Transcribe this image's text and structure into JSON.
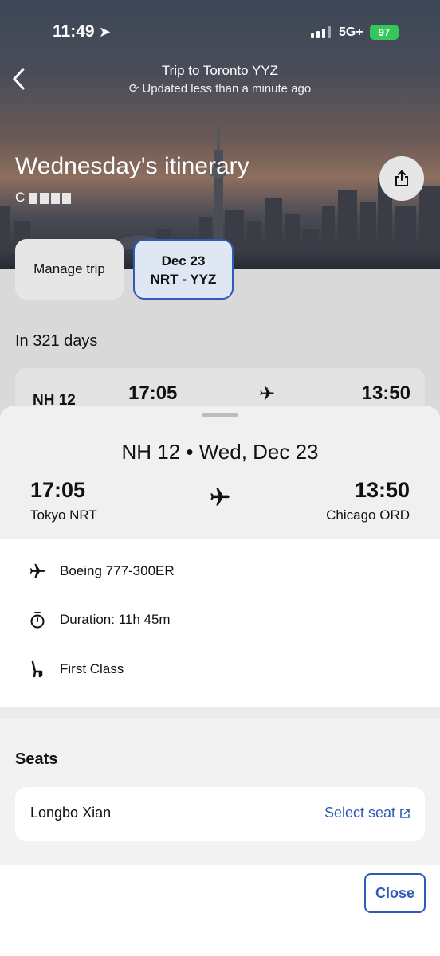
{
  "status_bar": {
    "time": "11:49",
    "network": "5G+",
    "battery": "97"
  },
  "header": {
    "trip_title": "Trip to Toronto YYZ",
    "updated": "Updated less than a minute ago",
    "day_title": "Wednesday's itinerary",
    "confirmation_prefix": "C"
  },
  "chips": {
    "manage": "Manage trip",
    "flight_date": "Dec 23",
    "flight_route": "NRT - YYZ"
  },
  "countdown": "In 321 days",
  "peek_card": {
    "flight": "NH 12",
    "departure_time": "17:05",
    "arrival_time": "13:50"
  },
  "sheet": {
    "title": "NH 12 • Wed, Dec 23",
    "departure_time": "17:05",
    "departure_city": "Tokyo NRT",
    "arrival_time": "13:50",
    "arrival_city": "Chicago ORD",
    "details": {
      "aircraft": "Boeing 777-300ER",
      "duration": "Duration: 11h 45m",
      "cabin": "First Class"
    },
    "seats_heading": "Seats",
    "passenger": "Longbo Xian",
    "select_seat": "Select seat",
    "close": "Close"
  },
  "colors": {
    "accent": "#2f5bb7",
    "battery": "#34c759"
  }
}
